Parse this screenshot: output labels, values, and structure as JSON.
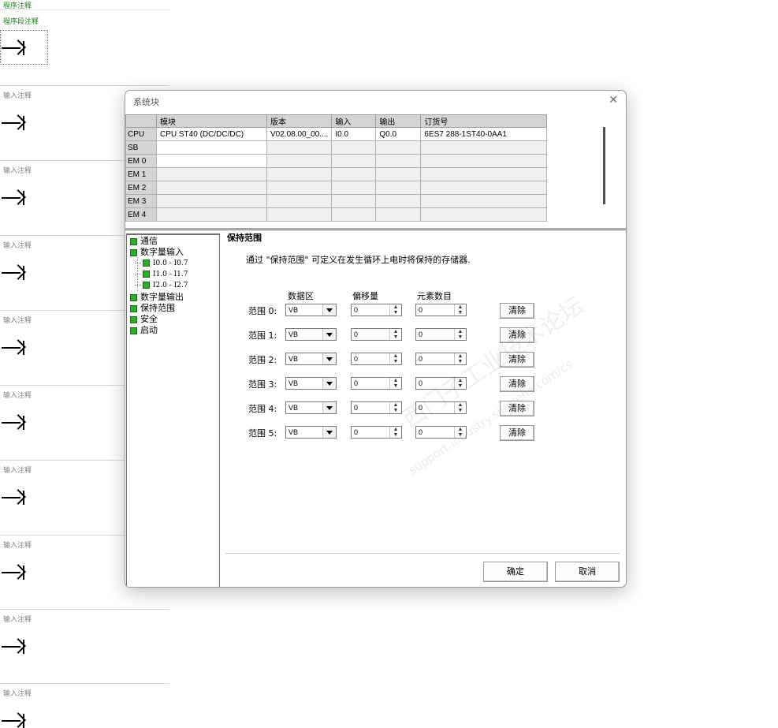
{
  "program": {
    "program_comment": "程序注释",
    "segment_comment": "程序段注释",
    "network_comment": "输入注释"
  },
  "dialog": {
    "title": "系统块",
    "close_glyph": "✕",
    "module_table": {
      "headers": [
        "",
        "模块",
        "版本",
        "输入",
        "输出",
        "订货号"
      ],
      "rows": [
        {
          "slot": "CPU",
          "module": "CPU ST40 (DC/DC/DC)",
          "version": "V02.08.00_00....",
          "input": "I0.0",
          "output": "Q0.0",
          "order": "6ES7 288-1ST40-0AA1"
        },
        {
          "slot": "SB",
          "module": "",
          "version": "",
          "input": "",
          "output": "",
          "order": ""
        },
        {
          "slot": "EM 0",
          "module": "",
          "version": "",
          "input": "",
          "output": "",
          "order": ""
        },
        {
          "slot": "EM 1",
          "module": "",
          "version": "",
          "input": "",
          "output": "",
          "order": ""
        },
        {
          "slot": "EM 2",
          "module": "",
          "version": "",
          "input": "",
          "output": "",
          "order": ""
        },
        {
          "slot": "EM 3",
          "module": "",
          "version": "",
          "input": "",
          "output": "",
          "order": ""
        },
        {
          "slot": "EM 4",
          "module": "",
          "version": "",
          "input": "",
          "output": "",
          "order": ""
        }
      ]
    },
    "tree": {
      "items": [
        {
          "label": "通信"
        },
        {
          "label": "数字量输入"
        },
        {
          "label": "I0.0 - I0.7",
          "sub": true
        },
        {
          "label": "I1.0 - I1.7",
          "sub": true
        },
        {
          "label": "I2.0 - I2.7",
          "sub": true
        },
        {
          "label": "数字量输出"
        },
        {
          "label": "保持范围"
        },
        {
          "label": "安全"
        },
        {
          "label": "启动"
        }
      ]
    },
    "panel": {
      "title": "保持范围",
      "description": "通过 \"保持范围\" 可定义在发生循环上电时将保持的存储器.",
      "col_area": "数据区",
      "col_offset": "偏移量",
      "col_count": "元素数目",
      "ranges": [
        {
          "label": "范围 0:",
          "area": "VB",
          "offset": "0",
          "count": "0",
          "clear": "清除"
        },
        {
          "label": "范围 1:",
          "area": "VB",
          "offset": "0",
          "count": "0",
          "clear": "清除"
        },
        {
          "label": "范围 2:",
          "area": "VB",
          "offset": "0",
          "count": "0",
          "clear": "清除"
        },
        {
          "label": "范围 3:",
          "area": "VB",
          "offset": "0",
          "count": "0",
          "clear": "清除"
        },
        {
          "label": "范围 4:",
          "area": "VB",
          "offset": "0",
          "count": "0",
          "clear": "清除"
        },
        {
          "label": "范围 5:",
          "area": "VB",
          "offset": "0",
          "count": "0",
          "clear": "清除"
        }
      ]
    },
    "ok_label": "确定",
    "cancel_label": "取消",
    "watermark": "西门子工业技术论坛",
    "watermark_url": "support.industry.siemens.com/cs"
  },
  "colors": {
    "comment_green": "#1a7f1a",
    "tree_node": "#2cae2c"
  }
}
